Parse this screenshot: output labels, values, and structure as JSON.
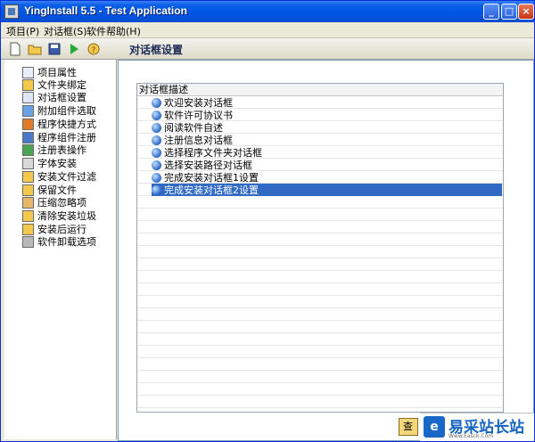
{
  "window": {
    "title": "YingInstall 5.5 - Test Application"
  },
  "menu": [
    "项目(P)",
    "对话框(S)",
    "软件帮助(H)"
  ],
  "toolbar": {
    "section_title": "对话框设置"
  },
  "sidebar": {
    "items": [
      {
        "label": "项目属性",
        "icon": "properties-icon"
      },
      {
        "label": "文件夹绑定",
        "icon": "folder-icon"
      },
      {
        "label": "对话框设置",
        "icon": "dialog-icon"
      },
      {
        "label": "附加组件选取",
        "icon": "component-icon"
      },
      {
        "label": "程序快捷方式",
        "icon": "shortcut-icon"
      },
      {
        "label": "程序组件注册",
        "icon": "register-icon"
      },
      {
        "label": "注册表操作",
        "icon": "registry-icon"
      },
      {
        "label": "字体安装",
        "icon": "font-icon"
      },
      {
        "label": "安装文件过滤",
        "icon": "filter-icon"
      },
      {
        "label": "保留文件",
        "icon": "keep-file-icon"
      },
      {
        "label": "压缩忽略项",
        "icon": "compress-icon"
      },
      {
        "label": "清除安装垃圾",
        "icon": "clean-icon"
      },
      {
        "label": "安装后运行",
        "icon": "run-icon"
      },
      {
        "label": "软件卸载选项",
        "icon": "uninstall-icon"
      }
    ]
  },
  "panel": {
    "header": "对话框描述",
    "rows": [
      {
        "label": "欢迎安装对话框",
        "selected": false
      },
      {
        "label": "软件许可协议书",
        "selected": false
      },
      {
        "label": "阅读软件自述",
        "selected": false
      },
      {
        "label": "注册信息对话框",
        "selected": false
      },
      {
        "label": "选择程序文件夹对话框",
        "selected": false
      },
      {
        "label": "选择安装路径对话框",
        "selected": false
      },
      {
        "label": "完成安装对话框1设置",
        "selected": false
      },
      {
        "label": "完成安装对话框2设置",
        "selected": true
      }
    ]
  },
  "bottom": {
    "view_button": "查"
  },
  "watermark": {
    "text": "易采站长站",
    "url": "Www.Easck.Com"
  }
}
